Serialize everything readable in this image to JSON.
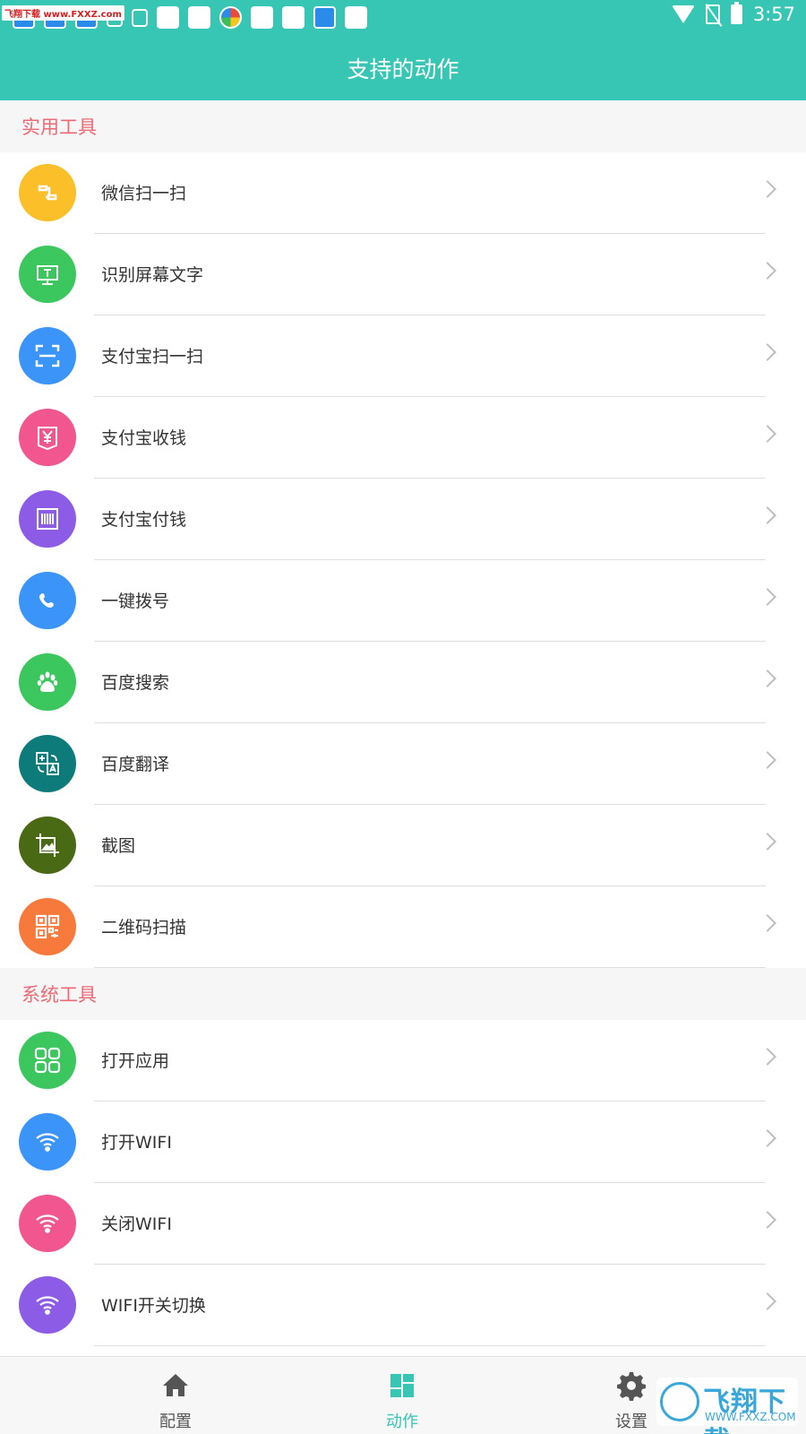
{
  "statusbar": {
    "time": "3:57",
    "watermark": "飞翔下载 www.FXXZ.com"
  },
  "appbar": {
    "title": "支持的动作"
  },
  "sections": [
    {
      "title": "实用工具",
      "items": [
        {
          "label": "微信扫一扫",
          "icon": "wechat-scan-icon",
          "color": "#fbbf2a"
        },
        {
          "label": "识别屏幕文字",
          "icon": "screen-text-icon",
          "color": "#3cc75e"
        },
        {
          "label": "支付宝扫一扫",
          "icon": "scan-frame-icon",
          "color": "#3b94f7"
        },
        {
          "label": "支付宝收钱",
          "icon": "yuan-receive-icon",
          "color": "#f2568f"
        },
        {
          "label": "支付宝付钱",
          "icon": "barcode-icon",
          "color": "#8c5ce6"
        },
        {
          "label": "一键拨号",
          "icon": "phone-icon",
          "color": "#3b94f7"
        },
        {
          "label": "百度搜索",
          "icon": "paw-icon",
          "color": "#3cc75e"
        },
        {
          "label": "百度翻译",
          "icon": "translate-icon",
          "color": "#0e7b7b"
        },
        {
          "label": "截图",
          "icon": "screenshot-icon",
          "color": "#4a6915"
        },
        {
          "label": "二维码扫描",
          "icon": "qrcode-icon",
          "color": "#f77a3c"
        }
      ]
    },
    {
      "title": "系统工具",
      "items": [
        {
          "label": "打开应用",
          "icon": "apps-grid-icon",
          "color": "#3cc75e"
        },
        {
          "label": "打开WIFI",
          "icon": "wifi-icon",
          "color": "#3b94f7"
        },
        {
          "label": "关闭WIFI",
          "icon": "wifi-icon",
          "color": "#f2568f"
        },
        {
          "label": "WIFI开关切换",
          "icon": "wifi-icon",
          "color": "#8c5ce6"
        }
      ]
    }
  ],
  "bottomnav": [
    {
      "label": "配置",
      "icon": "home-icon",
      "active": false
    },
    {
      "label": "动作",
      "icon": "dashboard-icon",
      "active": true
    },
    {
      "label": "设置",
      "icon": "gear-icon",
      "active": false
    }
  ],
  "colors": {
    "primary": "#36c6b3",
    "section_title": "#ec6a74"
  },
  "watermark_bottom": {
    "text": "飞翔下载",
    "domain": "WWW.FXXZ.COM"
  }
}
